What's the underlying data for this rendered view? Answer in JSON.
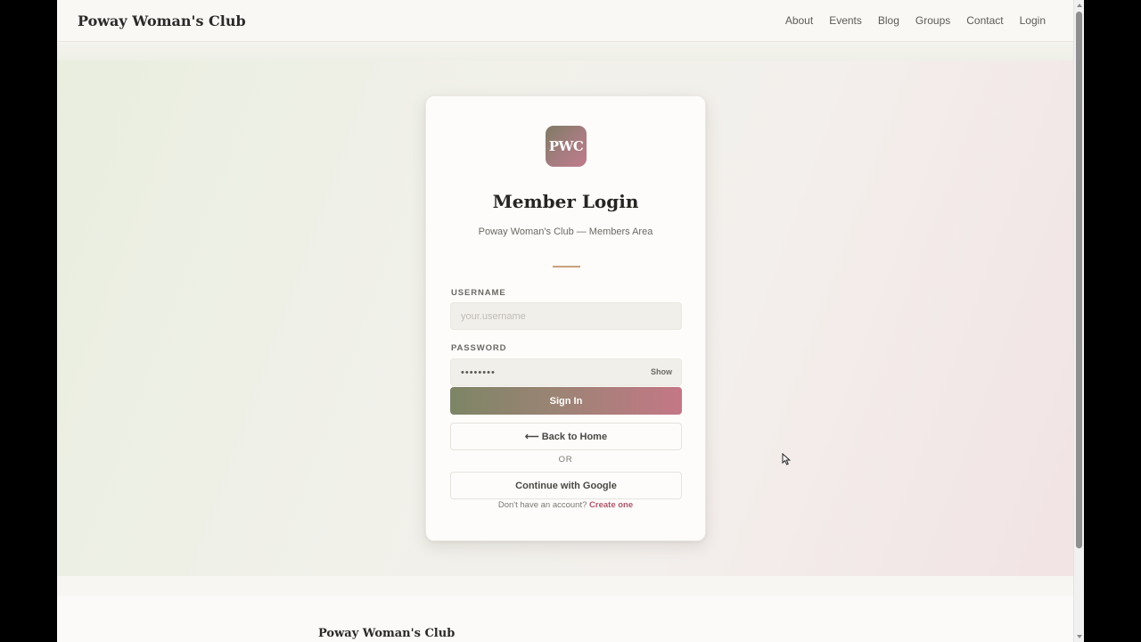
{
  "site": {
    "brand": "Poway Woman's Club"
  },
  "nav": {
    "items": [
      "About",
      "Events",
      "Blog",
      "Groups",
      "Contact",
      "Login"
    ]
  },
  "login": {
    "logo_text": "PWC",
    "title": "Member Login",
    "subtitle": "Poway Woman's Club — Members Area",
    "username_label": "USERNAME",
    "username_placeholder": "your.username",
    "username_value": "",
    "password_label": "PASSWORD",
    "password_value": "••••••••",
    "show_label": "Show",
    "signin_label": "Sign In",
    "back_label": "⟵ Back to Home",
    "or_label": "OR",
    "google_label": "Continue with Google",
    "signup_prompt": "Don't have an account?",
    "signup_link": "Create one"
  },
  "footer": {
    "brand": "Poway Woman's Club"
  },
  "colors": {
    "accent_start": "#7d8566",
    "accent_end": "#c47786",
    "link": "#b0566c",
    "divider": "#c9a07c"
  },
  "icons": {
    "cursor": "arrow-cursor-icon"
  }
}
